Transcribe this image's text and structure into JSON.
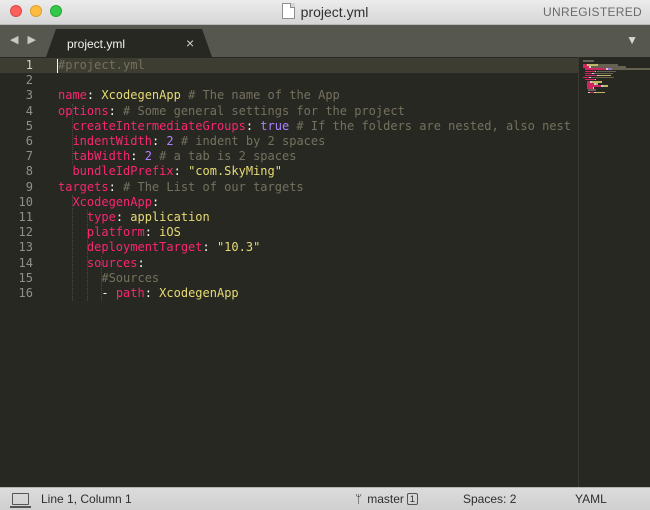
{
  "window": {
    "title": "project.yml",
    "unregistered_label": "UNREGISTERED"
  },
  "tabs": {
    "nav": "◀ ▶",
    "active_tab": "project.yml",
    "close_glyph": "×",
    "dropdown_glyph": "▼"
  },
  "editor": {
    "line_numbers": [
      "1",
      "2",
      "3",
      "4",
      "5",
      "6",
      "7",
      "8",
      "9",
      "10",
      "11",
      "12",
      "13",
      "14",
      "15",
      "16"
    ],
    "lines": [
      [
        {
          "t": "#project.yml",
          "c": "comment"
        }
      ],
      [],
      [
        {
          "t": "name",
          "c": "key"
        },
        {
          "t": ": ",
          "c": "plain"
        },
        {
          "t": "XcodegenApp",
          "c": "string"
        },
        {
          "t": " # The name of the App",
          "c": "comment"
        }
      ],
      [
        {
          "t": "options",
          "c": "key"
        },
        {
          "t": ": ",
          "c": "plain"
        },
        {
          "t": "# Some general settings for the project",
          "c": "comment"
        }
      ],
      [
        {
          "t": "  ",
          "c": "plain"
        },
        {
          "t": "createIntermediateGroups",
          "c": "key"
        },
        {
          "t": ": ",
          "c": "plain"
        },
        {
          "t": "true",
          "c": "const"
        },
        {
          "t": " # If the folders are nested, also nest th",
          "c": "comment"
        }
      ],
      [
        {
          "t": "  ",
          "c": "plain"
        },
        {
          "t": "indentWidth",
          "c": "key"
        },
        {
          "t": ": ",
          "c": "plain"
        },
        {
          "t": "2",
          "c": "const"
        },
        {
          "t": " # indent by 2 spaces",
          "c": "comment"
        }
      ],
      [
        {
          "t": "  ",
          "c": "plain"
        },
        {
          "t": "tabWidth",
          "c": "key"
        },
        {
          "t": ": ",
          "c": "plain"
        },
        {
          "t": "2",
          "c": "const"
        },
        {
          "t": " # a tab is 2 spaces",
          "c": "comment"
        }
      ],
      [
        {
          "t": "  ",
          "c": "plain"
        },
        {
          "t": "bundleIdPrefix",
          "c": "key"
        },
        {
          "t": ": ",
          "c": "plain"
        },
        {
          "t": "\"com.SkyMing\"",
          "c": "string"
        }
      ],
      [
        {
          "t": "targets",
          "c": "key"
        },
        {
          "t": ": ",
          "c": "plain"
        },
        {
          "t": "# The List of our targets",
          "c": "comment"
        }
      ],
      [
        {
          "t": "  ",
          "c": "plain"
        },
        {
          "t": "XcodegenApp",
          "c": "key"
        },
        {
          "t": ":",
          "c": "plain"
        }
      ],
      [
        {
          "t": "    ",
          "c": "plain"
        },
        {
          "t": "type",
          "c": "key"
        },
        {
          "t": ": ",
          "c": "plain"
        },
        {
          "t": "application",
          "c": "string"
        }
      ],
      [
        {
          "t": "    ",
          "c": "plain"
        },
        {
          "t": "platform",
          "c": "key"
        },
        {
          "t": ": ",
          "c": "plain"
        },
        {
          "t": "iOS",
          "c": "string"
        }
      ],
      [
        {
          "t": "    ",
          "c": "plain"
        },
        {
          "t": "deploymentTarget",
          "c": "key"
        },
        {
          "t": ": ",
          "c": "plain"
        },
        {
          "t": "\"10.3\"",
          "c": "string"
        }
      ],
      [
        {
          "t": "    ",
          "c": "plain"
        },
        {
          "t": "sources",
          "c": "key"
        },
        {
          "t": ":",
          "c": "plain"
        }
      ],
      [
        {
          "t": "      ",
          "c": "plain"
        },
        {
          "t": "#Sources",
          "c": "comment"
        }
      ],
      [
        {
          "t": "      ",
          "c": "plain"
        },
        {
          "t": "- ",
          "c": "plain"
        },
        {
          "t": "path",
          "c": "key"
        },
        {
          "t": ": ",
          "c": "plain"
        },
        {
          "t": "XcodegenApp",
          "c": "string"
        }
      ]
    ],
    "syntax_colors": {
      "key": "#f92672",
      "string": "#e6db74",
      "comment": "#75715e",
      "const": "#ae81ff",
      "plain": "#f8f8f2"
    }
  },
  "statusbar": {
    "panel_icon": "panel-toggle-icon",
    "position": "Line 1, Column 1",
    "branch_icon": "git-branch-icon",
    "branch": "master",
    "branch_count": "1",
    "spaces": "Spaces: 2",
    "syntax": "YAML"
  }
}
